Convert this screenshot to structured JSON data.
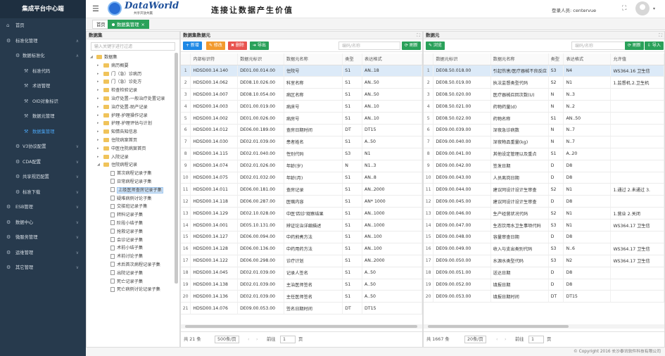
{
  "app": {
    "title": "集成平台中心端"
  },
  "header": {
    "logo": "DataWorld",
    "logo_sub": "共享开放共赢",
    "slogan": "连接让数据产生价值",
    "user": "登录人员:  centervue"
  },
  "tabs": {
    "home": "首页",
    "active": "数据集管理"
  },
  "sidebar": [
    {
      "label": "首页",
      "icon": "home-icon",
      "level": 0,
      "arrow": ""
    },
    {
      "label": "标准化管理",
      "icon": "settings-icon",
      "level": 0,
      "arrow": "∧"
    },
    {
      "label": "数据标准化",
      "icon": "gear-icon",
      "level": 1,
      "arrow": "∧"
    },
    {
      "label": "标准代码",
      "icon": "tool-icon",
      "level": 2,
      "arrow": ""
    },
    {
      "label": "术语管理",
      "icon": "tool-icon",
      "level": 2,
      "arrow": ""
    },
    {
      "label": "OID对象标识",
      "icon": "tool-icon",
      "level": 2,
      "arrow": ""
    },
    {
      "label": "数据元管理",
      "icon": "tool-icon",
      "level": 2,
      "arrow": ""
    },
    {
      "label": "数据集管理",
      "icon": "tool-icon",
      "level": 2,
      "arrow": "",
      "active": true
    },
    {
      "label": "V3协议配置",
      "icon": "gear-icon",
      "level": 1,
      "arrow": "∨"
    },
    {
      "label": "CDA配置",
      "icon": "gear-icon",
      "level": 1,
      "arrow": "∨"
    },
    {
      "label": "共享规范配置",
      "icon": "gear-icon",
      "level": 1,
      "arrow": "∨"
    },
    {
      "label": "标准下载",
      "icon": "gear-icon",
      "level": 1,
      "arrow": "∨"
    },
    {
      "label": "ESB管理",
      "icon": "settings-icon",
      "level": 0,
      "arrow": "∨"
    },
    {
      "label": "数据中心",
      "icon": "settings-icon",
      "level": 0,
      "arrow": "∨"
    },
    {
      "label": "微服务管理",
      "icon": "settings-icon",
      "level": 0,
      "arrow": "∨"
    },
    {
      "label": "运维管理",
      "icon": "settings-icon",
      "level": 0,
      "arrow": "∨"
    },
    {
      "label": "其它管理",
      "icon": "settings-icon",
      "level": 0,
      "arrow": "∨"
    }
  ],
  "tree_panel": {
    "title": "数据集",
    "search_placeholder": "输入关键字进行过滤",
    "items": [
      {
        "label": "数据集",
        "indent": 0,
        "toggle": "◢",
        "type": "folder"
      },
      {
        "label": "病历概要",
        "indent": 1,
        "toggle": "▸",
        "type": "folder"
      },
      {
        "label": "门（急）诊病历",
        "indent": 1,
        "toggle": "▸",
        "type": "folder"
      },
      {
        "label": "门（急）诊处方",
        "indent": 1,
        "toggle": "▸",
        "type": "folder"
      },
      {
        "label": "检查检验记录",
        "indent": 1,
        "toggle": "▸",
        "type": "folder"
      },
      {
        "label": "治疗处置-一般治疗处置记录",
        "indent": 1,
        "toggle": "▸",
        "type": "folder"
      },
      {
        "label": "治疗处置-助产记录",
        "indent": 1,
        "toggle": "▸",
        "type": "folder"
      },
      {
        "label": "护理-护理操作记录",
        "indent": 1,
        "toggle": "▸",
        "type": "folder"
      },
      {
        "label": "护理-护理评估与计划",
        "indent": 1,
        "toggle": "▸",
        "type": "folder"
      },
      {
        "label": "知情告知信息",
        "indent": 1,
        "toggle": "▸",
        "type": "folder"
      },
      {
        "label": "住院病案首页",
        "indent": 1,
        "toggle": "▸",
        "type": "folder"
      },
      {
        "label": "中医住院病案首页",
        "indent": 1,
        "toggle": "▸",
        "type": "folder"
      },
      {
        "label": "入院记录",
        "indent": 1,
        "toggle": "▸",
        "type": "folder"
      },
      {
        "label": "住院病程记录",
        "indent": 1,
        "toggle": "◢",
        "type": "folder"
      },
      {
        "label": "首次病程记录子集",
        "indent": 2,
        "toggle": "",
        "type": "file"
      },
      {
        "label": "日常病程记录子集",
        "indent": 2,
        "toggle": "",
        "type": "file"
      },
      {
        "label": "上级医师查房记录子集",
        "indent": 2,
        "toggle": "",
        "type": "file",
        "selected": true
      },
      {
        "label": "疑难病例讨论子集",
        "indent": 2,
        "toggle": "",
        "type": "file"
      },
      {
        "label": "交接班记录子集",
        "indent": 2,
        "toggle": "",
        "type": "file"
      },
      {
        "label": "转科记录子集",
        "indent": 2,
        "toggle": "",
        "type": "file"
      },
      {
        "label": "阶段小结子集",
        "indent": 2,
        "toggle": "",
        "type": "file"
      },
      {
        "label": "抢救记录子集",
        "indent": 2,
        "toggle": "",
        "type": "file"
      },
      {
        "label": "会诊记录子集",
        "indent": 2,
        "toggle": "",
        "type": "file"
      },
      {
        "label": "术前小结子集",
        "indent": 2,
        "toggle": "",
        "type": "file"
      },
      {
        "label": "术前讨论子集",
        "indent": 2,
        "toggle": "",
        "type": "file"
      },
      {
        "label": "术后首次病程记录子集",
        "indent": 2,
        "toggle": "",
        "type": "file"
      },
      {
        "label": "出院记录子集",
        "indent": 2,
        "toggle": "",
        "type": "file"
      },
      {
        "label": "死亡记录子集",
        "indent": 2,
        "toggle": "",
        "type": "file"
      },
      {
        "label": "死亡病例讨论记录子集",
        "indent": 2,
        "toggle": "",
        "type": "file"
      }
    ]
  },
  "ds_panel": {
    "title": "数据集数据元",
    "buttons": {
      "add": "+ 新增",
      "edit": "✎ 修改",
      "delete": "✖ 删除",
      "export": "➜ 导出",
      "refresh": "⟳ 刷新"
    },
    "search_placeholder": "编码/名称",
    "headers": [
      "",
      "内部标识符",
      "数据元标识",
      "数据元名称",
      "类型",
      "表达格式"
    ],
    "rows": [
      [
        "1",
        "HDSD00.14.140",
        "DE01.00.014.00",
        "住院号",
        "S1",
        "AN..18"
      ],
      [
        "2",
        "HDSD00.14.062",
        "DE08.10.026.00",
        "科室名称",
        "S1",
        "AN..50"
      ],
      [
        "3",
        "HDSD00.14.007",
        "DE08.10.054.00",
        "病区名称",
        "S1",
        "AN..50"
      ],
      [
        "4",
        "HDSD00.14.003",
        "DE01.00.019.00",
        "病床号",
        "S1",
        "AN..10"
      ],
      [
        "5",
        "HDSD00.14.002",
        "DE01.00.026.00",
        "病房号",
        "S1",
        "AN..10"
      ],
      [
        "6",
        "HDSD00.14.012",
        "DE06.00.189.00",
        "查房日期时间",
        "DT",
        "DT15"
      ],
      [
        "7",
        "HDSD00.14.030",
        "DE02.01.039.00",
        "患者姓名",
        "S1",
        "A..50"
      ],
      [
        "8",
        "HDSD00.14.115",
        "DE02.01.040.00",
        "性别代码",
        "S3",
        "N1"
      ],
      [
        "9",
        "HDSD00.14.074",
        "DE02.01.026.00",
        "年龄(岁)",
        "N",
        "N1..3"
      ],
      [
        "10",
        "HDSD00.14.075",
        "DE02.01.032.00",
        "年龄(月)",
        "S1",
        "AN..8"
      ],
      [
        "11",
        "HDSD00.14.011",
        "DE06.00.181.00",
        "查房记录",
        "S1",
        "AN..2000"
      ],
      [
        "12",
        "HDSD00.14.118",
        "DE06.00.287.00",
        "医嘱内容",
        "S1",
        "AN* 1000"
      ],
      [
        "13",
        "HDSD00.14.129",
        "DE02.10.028.00",
        "中医'四诊'观察结果",
        "S1",
        "AN..1000"
      ],
      [
        "14",
        "HDSD00.14.001",
        "DE05.10.131.00",
        "辨证论治详细描述",
        "S1",
        "AN..1000"
      ],
      [
        "15",
        "HDSD00.14.127",
        "DE06.00.094.00",
        "中药煎煮方法",
        "S1",
        "AN..100"
      ],
      [
        "16",
        "HDSD00.14.128",
        "DE06.00.136.00",
        "中药用药方法",
        "S1",
        "AN..100"
      ],
      [
        "17",
        "HDSD00.14.122",
        "DE06.00.298.00",
        "诊疗计划",
        "S1",
        "AN..2000"
      ],
      [
        "18",
        "HDSD00.14.045",
        "DE02.01.039.00",
        "记录人签名",
        "S1",
        "A..50"
      ],
      [
        "19",
        "HDSD00.14.138",
        "DE02.01.039.00",
        "主治医师签名",
        "S1",
        "A..50"
      ],
      [
        "20",
        "HDSD00.14.136",
        "DE02.01.039.00",
        "主任医师签名",
        "S1",
        "A..50"
      ],
      [
        "21",
        "HDSD00.14.076",
        "DE09.00.053.00",
        "签名日期时间",
        "DT",
        "DT15"
      ]
    ],
    "pager": {
      "total": "共 21 条",
      "size": "500条/页",
      "prev": "前往",
      "page": "1",
      "unit": "页"
    }
  },
  "de_panel": {
    "title": "数据元",
    "buttons": {
      "browse": "✎ 浏览",
      "refresh": "⟳ 刷新",
      "import": "⇩ 导入"
    },
    "search_placeholder": "编码/名称",
    "headers": [
      "",
      "数据元标识",
      "数据元名称",
      "类型",
      "表达格式",
      "允许值"
    ],
    "rows": [
      [
        "1",
        "DE08.50.018.00",
        "引起伤害/医疗器械不良反应",
        "S3",
        "N4",
        "WS364.16 卫生信"
      ],
      [
        "2",
        "DE08.50.019.00",
        "执法监督类型代码",
        "S2",
        "N1",
        "1.监督机.2.卫生机"
      ],
      [
        "3",
        "DE08.50.020.00",
        "医疗器械召回次数(U)",
        "N",
        "N..3",
        ""
      ],
      [
        "4",
        "DE08.50.021.00",
        "药物药量(d)",
        "N",
        "N..2",
        ""
      ],
      [
        "5",
        "DE08.50.022.00",
        "药物名称",
        "S1",
        "AN..50",
        ""
      ],
      [
        "6",
        "DE09.00.039.00",
        "深夜急诊病数",
        "N",
        "N..7",
        ""
      ],
      [
        "7",
        "DE09.00.040.00",
        "深夜物品重量(kg)",
        "N",
        "N..7",
        ""
      ],
      [
        "8",
        "DE09.00.041.00",
        "其他设定管理以及重点",
        "S1",
        "A..20",
        ""
      ],
      [
        "9",
        "DE09.00.042.00",
        "签发日期",
        "D",
        "D8",
        ""
      ],
      [
        "10",
        "DE09.00.043.00",
        "人员离岗日期",
        "D",
        "D8",
        ""
      ],
      [
        "11",
        "DE09.00.044.00",
        "建议同设计设计生审查",
        "S2",
        "N1",
        "1.通过 2.未通过 3."
      ],
      [
        "12",
        "DE09.00.045.00",
        "建议同设计设计生审查",
        "D",
        "D8",
        ""
      ],
      [
        "13",
        "DE09.00.046.00",
        "生产经营状况代码",
        "S2",
        "N1",
        "1.营业 2.关闭"
      ],
      [
        "14",
        "DE09.00.047.00",
        "生态饮用水卫生事项代码",
        "S3",
        "N1",
        "WS364.17 卫生信"
      ],
      [
        "15",
        "DE09.00.048.00",
        "容量审查日期",
        "D",
        "D8",
        ""
      ],
      [
        "16",
        "DE09.00.049.00",
        "收入与支出类别代码",
        "S3",
        "N..6",
        "WS364.17 卫生信"
      ],
      [
        "17",
        "DE09.00.050.00",
        "水源水类型代码",
        "S3",
        "N2",
        "WS364.17 卫生信"
      ],
      [
        "18",
        "DE09.00.051.00",
        "送达日期",
        "D",
        "D8",
        ""
      ],
      [
        "19",
        "DE09.00.052.00",
        "填报日期",
        "D",
        "D8",
        ""
      ],
      [
        "20",
        "DE09.00.053.00",
        "填报日期时间",
        "DT",
        "DT15",
        ""
      ]
    ],
    "pager": {
      "total": "共 1667 条",
      "size": "20条/页",
      "prev": "前往",
      "page": "1",
      "unit": "页"
    }
  },
  "footer": "© Copyright 2016 长沙泰讯软件科技有限公司"
}
